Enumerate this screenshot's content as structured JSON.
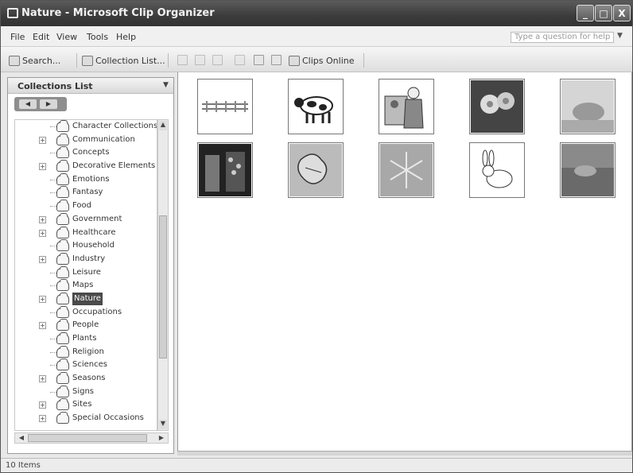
{
  "window": {
    "title": "Nature - Microsoft Clip Organizer",
    "min": "_",
    "max": "□",
    "close": "X"
  },
  "menu": {
    "file": "File",
    "edit": "Edit",
    "view": "View",
    "tools": "Tools",
    "help": "Help",
    "help_placeholder": "Type a question for help"
  },
  "toolbar": {
    "search": "Search...",
    "collection_list": "Collection List...",
    "clips_online": "Clips Online"
  },
  "pane": {
    "header": "Collections List",
    "nav_back": "◀",
    "nav_forward": "▶"
  },
  "tree": {
    "items": [
      {
        "label": "Character Collections",
        "expandable": false,
        "selected": false
      },
      {
        "label": "Communication",
        "expandable": true,
        "selected": false
      },
      {
        "label": "Concepts",
        "expandable": false,
        "selected": false
      },
      {
        "label": "Decorative Elements",
        "expandable": true,
        "selected": false
      },
      {
        "label": "Emotions",
        "expandable": false,
        "selected": false
      },
      {
        "label": "Fantasy",
        "expandable": false,
        "selected": false
      },
      {
        "label": "Food",
        "expandable": false,
        "selected": false
      },
      {
        "label": "Government",
        "expandable": true,
        "selected": false
      },
      {
        "label": "Healthcare",
        "expandable": true,
        "selected": false
      },
      {
        "label": "Household",
        "expandable": false,
        "selected": false
      },
      {
        "label": "Industry",
        "expandable": true,
        "selected": false
      },
      {
        "label": "Leisure",
        "expandable": false,
        "selected": false
      },
      {
        "label": "Maps",
        "expandable": false,
        "selected": false
      },
      {
        "label": "Nature",
        "expandable": true,
        "selected": true
      },
      {
        "label": "Occupations",
        "expandable": false,
        "selected": false
      },
      {
        "label": "People",
        "expandable": true,
        "selected": false
      },
      {
        "label": "Plants",
        "expandable": false,
        "selected": false
      },
      {
        "label": "Religion",
        "expandable": false,
        "selected": false
      },
      {
        "label": "Sciences",
        "expandable": false,
        "selected": false
      },
      {
        "label": "Seasons",
        "expandable": true,
        "selected": false
      },
      {
        "label": "Signs",
        "expandable": false,
        "selected": false
      },
      {
        "label": "Sites",
        "expandable": true,
        "selected": false
      },
      {
        "label": "Special Occasions",
        "expandable": true,
        "selected": false
      }
    ]
  },
  "clips": [
    {
      "name": "fence-clip"
    },
    {
      "name": "cow-clip"
    },
    {
      "name": "farmer-clip"
    },
    {
      "name": "flowers-clip"
    },
    {
      "name": "animal-photo-clip"
    },
    {
      "name": "plants-clip"
    },
    {
      "name": "leaves-clip"
    },
    {
      "name": "snowflake-clip"
    },
    {
      "name": "rabbit-clip"
    },
    {
      "name": "field-photo-clip"
    }
  ],
  "status": {
    "text": "10 Items"
  }
}
